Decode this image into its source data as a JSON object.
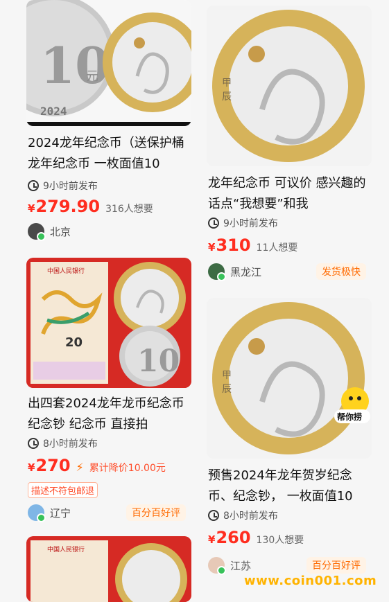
{
  "items": [
    {
      "title": "2024龙年纪念币（送保护桶 龙年纪念币 一枚面值10",
      "time": "9小时前发布",
      "currency": "¥",
      "price": "279.90",
      "wants": "316人想要",
      "location": "北京"
    },
    {
      "title": "龙年纪念币 可议价 感兴趣的话点“我想要”和我",
      "time": "9小时前发布",
      "currency": "¥",
      "price": "310",
      "wants": "11人想要",
      "location": "黑龙江",
      "badge": "发货极快"
    },
    {
      "title": "出四套2024龙年龙币纪念币纪念钞 纪念币 直接拍",
      "time": "8小时前发布",
      "currency": "¥",
      "price": "270",
      "discount": "累计降价10.00元",
      "tag": "描述不符包邮退",
      "location": "辽宁",
      "badge": "百分百好评"
    },
    {
      "title": "预售2024年龙年贺岁纪念币、纪念钞， 一枚面值10",
      "time": "8小时前发布",
      "currency": "¥",
      "price": "260",
      "wants": "130人想要",
      "location": "江苏",
      "badge": "百分百好评"
    }
  ],
  "coin_texts": {
    "face_value": "10",
    "yuan": "元",
    "year": "2024",
    "jia": "甲",
    "chen": "辰",
    "note_value": "20",
    "bank": "中国人民银行"
  },
  "helper_label": "帮你捞",
  "watermark": "www.coin001.com",
  "colors": {
    "price": "#ff2d1f",
    "badge": "#ff6a00",
    "coin_ring": "#d6b35a",
    "coin_center": "#e9e9e9"
  }
}
